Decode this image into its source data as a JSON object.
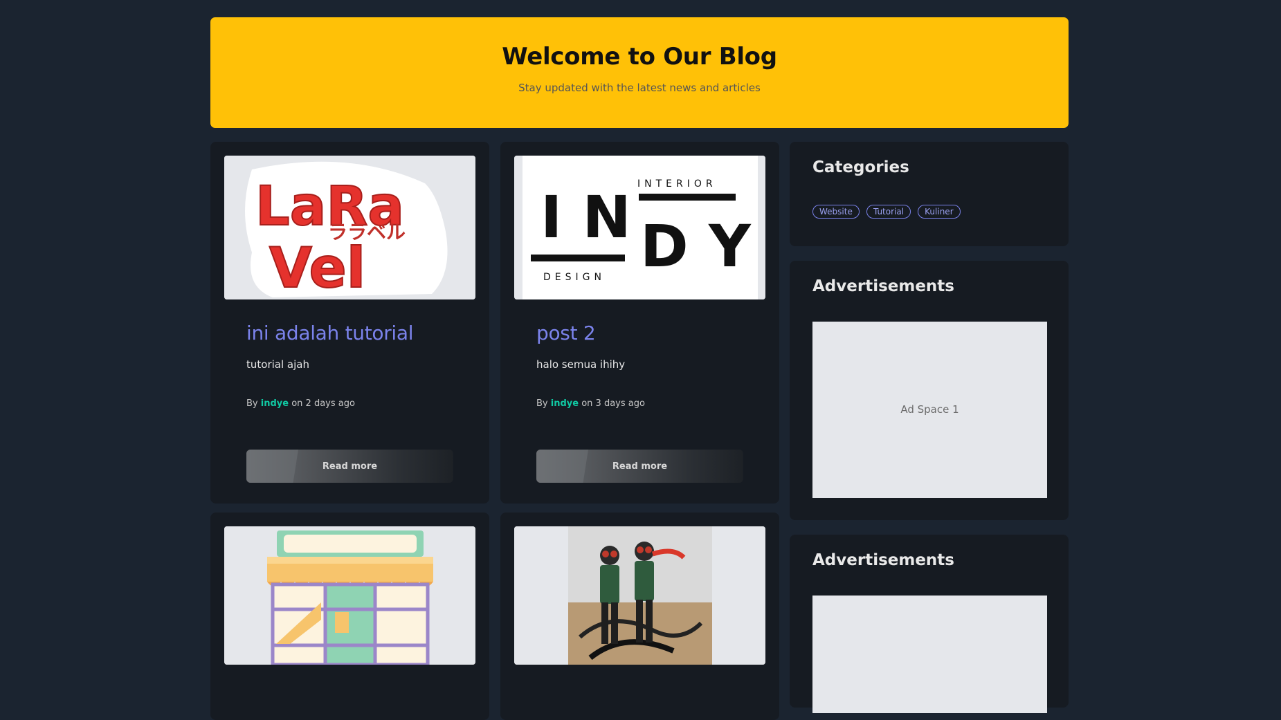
{
  "hero": {
    "title": "Welcome to Our Blog",
    "subtitle": "Stay updated with the latest news and articles"
  },
  "posts": [
    {
      "title": "ini adalah tutorial",
      "excerpt": "tutorial ajah",
      "by": "By",
      "author": "indye",
      "on": "on 2 days ago",
      "read_more": "Read more",
      "image": "laravel-logo-image"
    },
    {
      "title": "post 2",
      "excerpt": "halo semua ihihy",
      "by": "By",
      "author": "indye",
      "on": "on 3 days ago",
      "read_more": "Read more",
      "image": "indy-interior-design-logo-image"
    },
    {
      "image": "storefront-illustration-image"
    },
    {
      "image": "action-figures-photo-image"
    }
  ],
  "sidebar": {
    "categories_title": "Categories",
    "categories": [
      "Website",
      "Tutorial",
      "Kuliner"
    ],
    "ads_title_1": "Advertisements",
    "ad_1": "Ad Space 1",
    "ads_title_2": "Advertisements"
  },
  "colors": {
    "background": "#1b2430",
    "card": "#161b22",
    "hero": "#ffc107",
    "post_title": "#7b83eb",
    "author": "#10c9a3"
  }
}
